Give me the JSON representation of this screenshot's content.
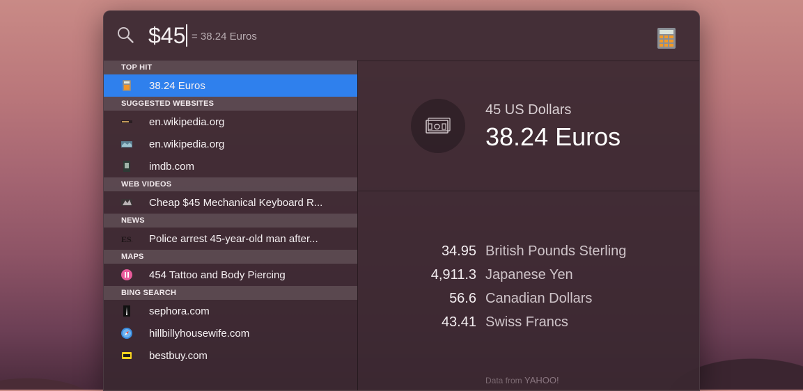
{
  "search": {
    "query": "$45",
    "hint": "= 38.24 Euros"
  },
  "sections": [
    {
      "title": "TOP HIT",
      "items": [
        {
          "label": "38.24 Euros",
          "icon": "calculator-icon",
          "selected": true
        }
      ]
    },
    {
      "title": "SUGGESTED WEBSITES",
      "items": [
        {
          "label": "en.wikipedia.org",
          "icon": "website-thumbnail-icon"
        },
        {
          "label": "en.wikipedia.org",
          "icon": "website-thumbnail-icon"
        },
        {
          "label": "imdb.com",
          "icon": "website-thumbnail-icon"
        }
      ]
    },
    {
      "title": "WEB VIDEOS",
      "items": [
        {
          "label": "Cheap $45 Mechanical Keyboard R...",
          "icon": "video-thumbnail-icon"
        }
      ]
    },
    {
      "title": "NEWS",
      "items": [
        {
          "label": "Police arrest 45-year-old man after...",
          "icon": "news-logo-icon"
        }
      ]
    },
    {
      "title": "MAPS",
      "items": [
        {
          "label": "454 Tattoo and Body Piercing",
          "icon": "map-pin-icon"
        }
      ]
    },
    {
      "title": "BING SEARCH",
      "items": [
        {
          "label": "sephora.com",
          "icon": "website-thumbnail-icon"
        },
        {
          "label": "hillbillyhousewife.com",
          "icon": "safari-icon"
        },
        {
          "label": "bestbuy.com",
          "icon": "bestbuy-logo-icon"
        }
      ]
    }
  ],
  "detail": {
    "from_amount": "45 US Dollars",
    "to_amount": "38.24 Euros",
    "rates": [
      {
        "value": "34.95",
        "currency": "British Pounds Sterling"
      },
      {
        "value": "4,911.3",
        "currency": "Japanese Yen"
      },
      {
        "value": "56.6",
        "currency": "Canadian Dollars"
      },
      {
        "value": "43.41",
        "currency": "Swiss Francs"
      }
    ],
    "source_prefix": "Data from",
    "source_name": "YAHOO!"
  },
  "colors": {
    "selection": "#2f80ed",
    "panel": "#3a2830"
  }
}
